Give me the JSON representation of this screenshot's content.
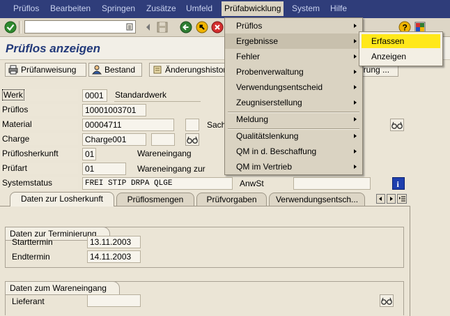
{
  "menubar": {
    "items": [
      "Prüflos",
      "Bearbeiten",
      "Springen",
      "Zusätze",
      "Umfeld",
      "Prüfabwicklung",
      "System",
      "Hilfe"
    ]
  },
  "toolbar": {
    "command_value": ""
  },
  "page_title": "Prüflos anzeigen",
  "app_toolbar": {
    "buttons": [
      "Prüfanweisung",
      "Bestand",
      "Änderungshistorie",
      "erung ..."
    ]
  },
  "form": {
    "werk": {
      "label": "Werk",
      "value": "0001",
      "text": "Standardwerk"
    },
    "prueflos": {
      "label": "Prüflos",
      "value": "10001003701"
    },
    "material": {
      "label": "Material",
      "value": "00004711",
      "right_label": "Sach"
    },
    "charge": {
      "label": "Charge",
      "value": "Charge001"
    },
    "herkunft": {
      "label": "Prüflosherkunft",
      "value": "01",
      "text": "Wareneingang"
    },
    "pruefart": {
      "label": "Prüfart",
      "value": "01",
      "text": "Wareneingang zur"
    },
    "systemstatus": {
      "label": "Systemstatus",
      "value": "FREI STIP DRPA QLGE",
      "right_label": "AnwSt"
    }
  },
  "tabs": [
    "Daten zur Losherkunft",
    "Prüflosmengen",
    "Prüfvorgaben",
    "Verwendungsentsch..."
  ],
  "groups": {
    "terminierung": {
      "title": "Daten zur Terminierung",
      "starttermin_label": "Starttermin",
      "starttermin": "13.11.2003",
      "endtermin_label": "Endtermin",
      "endtermin": "14.11.2003"
    },
    "wareneingang": {
      "title": "Daten zum Wareneingang",
      "lieferant_label": "Lieferant",
      "lieferant": ""
    }
  },
  "dropdown": {
    "items": [
      "Prüflos",
      "Ergebnisse",
      "Fehler",
      "Probenverwaltung",
      "Verwendungsentscheid",
      "Zeugniserstellung",
      "Meldung",
      "Qualitätslenkung",
      "QM in d. Beschaffung",
      "QM im Vertrieb"
    ]
  },
  "submenu": {
    "items": [
      "Erfassen",
      "Anzeigen"
    ]
  },
  "colors": {
    "menubar": "#2f3d7a",
    "highlight": "#ffe81a",
    "title": "#233a7a"
  }
}
